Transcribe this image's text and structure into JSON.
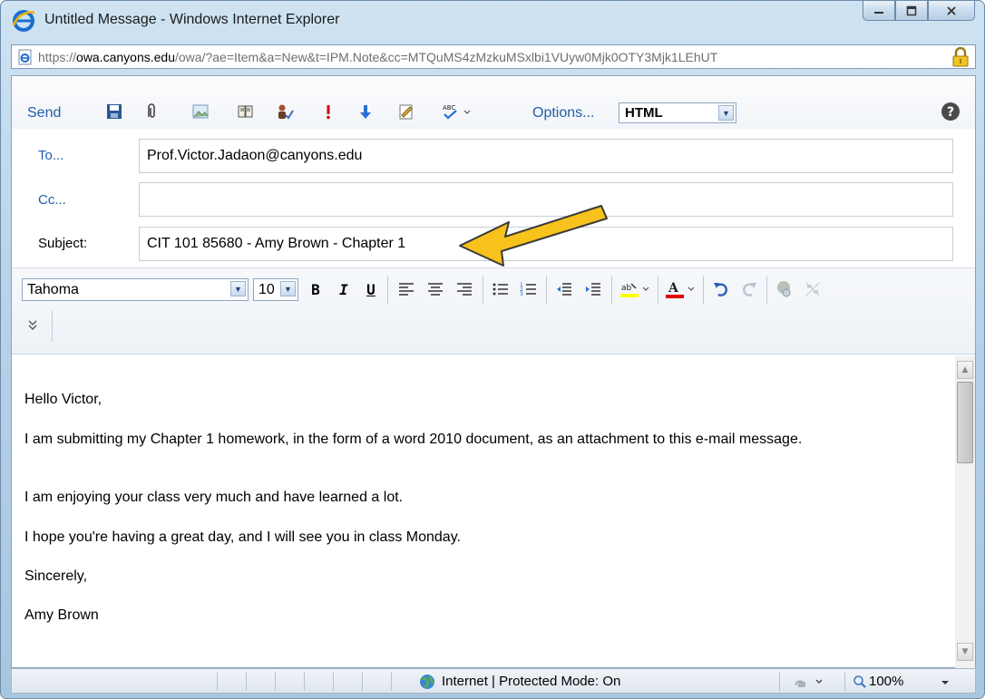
{
  "window": {
    "title": "Untitled Message - Windows Internet Explorer",
    "caption_buttons": [
      "minimize",
      "maximize",
      "close"
    ]
  },
  "address_bar": {
    "url_parts": [
      {
        "text": "https://",
        "style": "dim"
      },
      {
        "text": "owa.canyons.edu",
        "style": "hl"
      },
      {
        "text": "/owa/?ae=Item&a=New&t=IPM.Note&cc=MTQuMS4zMzkuMSxlbi1VUyw0Mjk0OTY3Mjk1LEhUT",
        "style": "dim"
      }
    ],
    "secure": true
  },
  "toolbar": {
    "send_label": "Send",
    "options_label": "Options...",
    "format_value": "HTML",
    "icons": [
      "save-icon",
      "attach-icon",
      "insert-image-icon",
      "address-book-icon",
      "check-names-icon",
      "high-importance-icon",
      "low-importance-icon",
      "signature-icon",
      "spell-check-icon",
      "help-icon"
    ]
  },
  "fields": {
    "to_label": "To...",
    "to_value": "Prof.Victor.Jadaon@canyons.edu",
    "cc_label": "Cc...",
    "cc_value": "",
    "subject_label": "Subject:",
    "subject_value": "CIT 101 85680 - Amy Brown - Chapter 1"
  },
  "formatting": {
    "font": "Tahoma",
    "size": "10",
    "bold": "B",
    "italic": "I",
    "underline": "U",
    "highlight_color": "#ffff00",
    "font_color": "#e00000"
  },
  "body": {
    "paragraphs": [
      "Hello Victor,",
      "I am submitting my Chapter 1 homework, in the form of a word 2010 document, as an attachment to this e-mail message.",
      "I am enjoying your class very much and have learned a lot.",
      "I hope you're having a great day, and I will see you in class Monday.",
      "Sincerely,",
      "Amy Brown"
    ]
  },
  "status_bar": {
    "zone_text": "Internet | Protected Mode: On",
    "zoom_text": "100%"
  },
  "colors": {
    "link_blue": "#1f5fa8",
    "arrow_fill": "#f7c21b",
    "arrow_stroke": "#3a3a3a"
  }
}
